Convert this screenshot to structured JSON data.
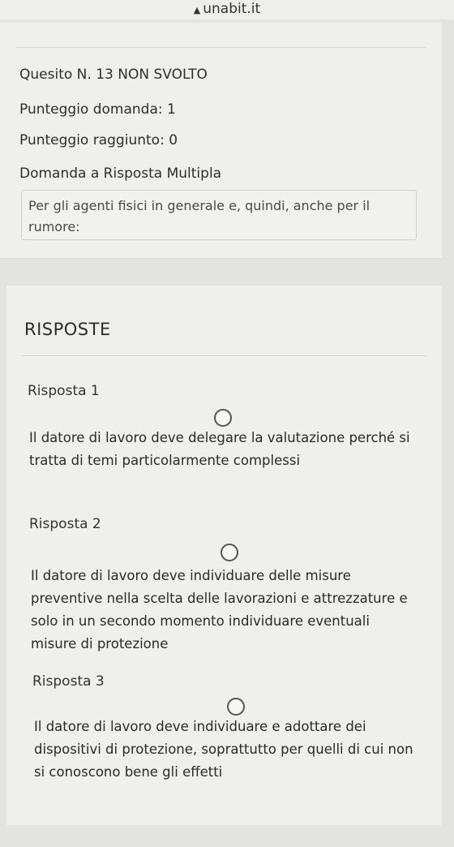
{
  "browser": {
    "url": "unabit.it"
  },
  "question": {
    "header": "Quesito N. 13 NON SVOLTO",
    "points_label": "Punteggio domanda: 1",
    "score_label": "Punteggio raggiunto: 0",
    "type_label": "Domanda a Risposta Multipla",
    "text": "Per gli agenti fisici in generale e, quindi, anche per il rumore:"
  },
  "answers": {
    "title": "RISPOSTE",
    "items": [
      {
        "label": "Risposta 1",
        "text": "Il datore di lavoro deve delegare la valutazione perché si tratta di temi particolarmente complessi",
        "selected": false
      },
      {
        "label": "Risposta 2",
        "text": "Il datore di lavoro deve individuare delle misure preventive nella scelta delle lavorazioni e attrezzature e solo in un secondo momento individuare eventuali misure di protezione",
        "selected": false
      },
      {
        "label": "Risposta 3",
        "text": "Il datore di lavoro deve individuare e adottare dei dispositivi di protezione, soprattutto per quelli di cui non si conoscono bene gli effetti",
        "selected": false
      }
    ]
  }
}
